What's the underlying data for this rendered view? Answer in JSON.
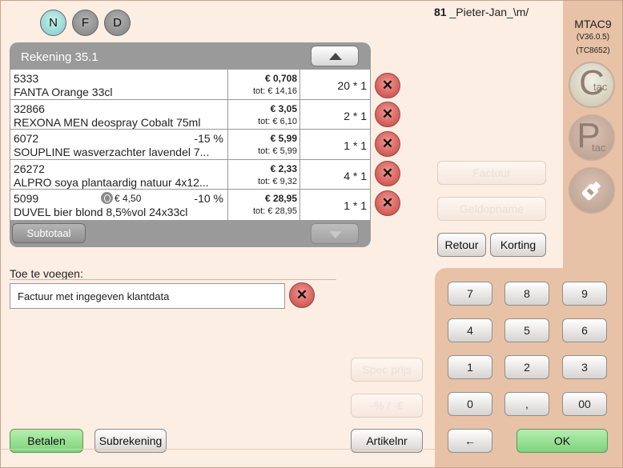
{
  "modes": [
    {
      "label": "N",
      "active": true
    },
    {
      "label": "F",
      "active": false
    },
    {
      "label": "D",
      "active": false
    }
  ],
  "user": {
    "number": "81",
    "name": "_Pieter-Jan_\\m/"
  },
  "terminal": {
    "name": "MTAC9",
    "version": "(V36.0.5)",
    "code": "(TC8652)"
  },
  "side_icons": {
    "c_tac": {
      "letter": "C",
      "sub": "tac"
    },
    "p_tac": {
      "letter": "P",
      "sub": "tac"
    },
    "bottle": "bottle-icon"
  },
  "rekening": {
    "title": "Rekening 35.1",
    "subtotal_label": "Subtotaal"
  },
  "rows": [
    {
      "code": "5333",
      "name": "FANTA Orange 33cl",
      "discount": "",
      "deposit": "",
      "price": "€ 0,708",
      "total": "tot: € 14,16",
      "qty": "20 * 1"
    },
    {
      "code": "32866",
      "name": "REXONA MEN deospray Cobalt 75ml",
      "discount": "",
      "deposit": "",
      "price": "€ 3,05",
      "total": "tot: € 6,10",
      "qty": "2 * 1"
    },
    {
      "code": "6072",
      "name": "SOUPLINE wasverzachter lavendel 7...",
      "discount": "-15 %",
      "deposit": "",
      "price": "€ 5,99",
      "total": "tot: € 5,99",
      "qty": "1 * 1"
    },
    {
      "code": "26272",
      "name": "ALPRO soya plantaardig natuur 4x12...",
      "discount": "",
      "deposit": "",
      "price": "€ 2,33",
      "total": "tot: € 9,32",
      "qty": "4 * 1"
    },
    {
      "code": "5099",
      "name": "DUVEL bier blond 8,5%vol 24x33cl",
      "discount": "-10 %",
      "deposit": "€ 4,50",
      "price": "€ 28,95",
      "total": "tot: € 28,95",
      "qty": "1 * 1"
    }
  ],
  "toevoegen": {
    "label": "Toe te voegen:",
    "value": "Factuur met ingegeven klantdata"
  },
  "buttons": {
    "factuur": "Factuur",
    "geldopname": "Geldopname",
    "retour": "Retour",
    "korting": "Korting",
    "spec_prijs": "Spec prijs",
    "percent_euro": "-% / -€",
    "artikelnr": "Artikelnr",
    "betalen": "Betalen",
    "subrekening": "Subrekening"
  },
  "keypad": {
    "keys": [
      "7",
      "8",
      "9",
      "4",
      "5",
      "6",
      "1",
      "2",
      "3",
      "0",
      ",",
      "00"
    ],
    "backspace": "←",
    "ok": "OK"
  },
  "colors": {
    "background": "#fdeee3",
    "panel": "#e7c2a7",
    "delete": "#d9534f",
    "ok": "#8fdc8b"
  }
}
